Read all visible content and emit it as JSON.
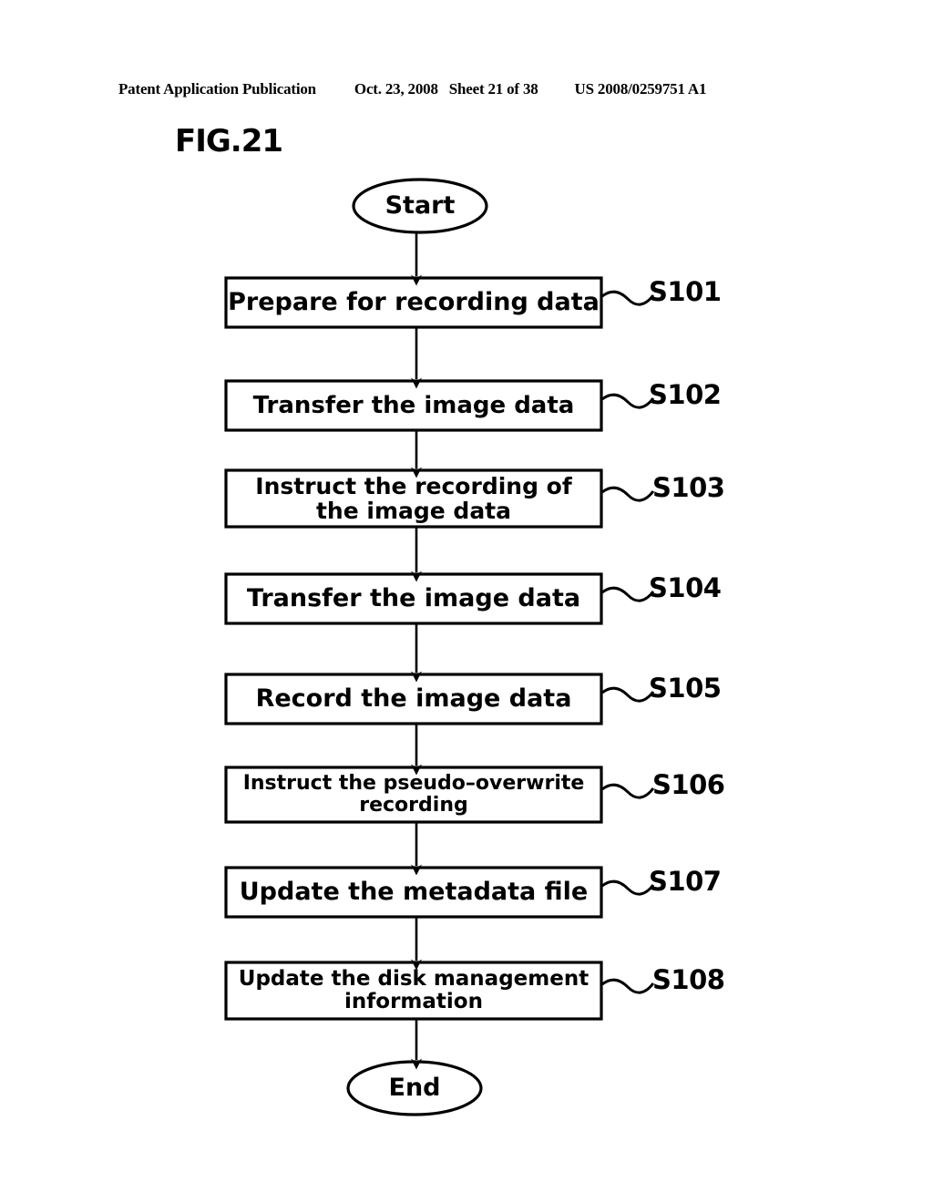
{
  "header": {
    "publication": "Patent Application Publication",
    "date": "Oct. 23, 2008",
    "sheet": "Sheet 21 of 38",
    "serial": "US 2008/0259751 A1"
  },
  "figure": {
    "label": "FIG.21"
  },
  "flowchart": {
    "type": "flowchart",
    "orientation": "vertical",
    "start_terminal": "Start",
    "end_terminal": "End",
    "steps": [
      {
        "id": "S101",
        "line1": "Prepare for recording data",
        "line2": "",
        "lines": 1
      },
      {
        "id": "S102",
        "line1": "Transfer the image data",
        "line2": "",
        "lines": 1
      },
      {
        "id": "S103",
        "line1": "Instruct the recording of",
        "line2": "the image data",
        "lines": 2
      },
      {
        "id": "S104",
        "line1": "Transfer the image data",
        "line2": "",
        "lines": 1
      },
      {
        "id": "S105",
        "line1": "Record the image data",
        "line2": "",
        "lines": 1
      },
      {
        "id": "S106",
        "line1": "Instruct the pseudo–overwrite",
        "line2": "recording",
        "lines": 2
      },
      {
        "id": "S107",
        "line1": "Update the metadata file",
        "line2": "",
        "lines": 1
      },
      {
        "id": "S108",
        "line1": "Update the disk management",
        "line2": "information",
        "lines": 2
      }
    ],
    "colors": {
      "stroke": "#000000",
      "fill": "#ffffff",
      "text": "#000000"
    }
  }
}
